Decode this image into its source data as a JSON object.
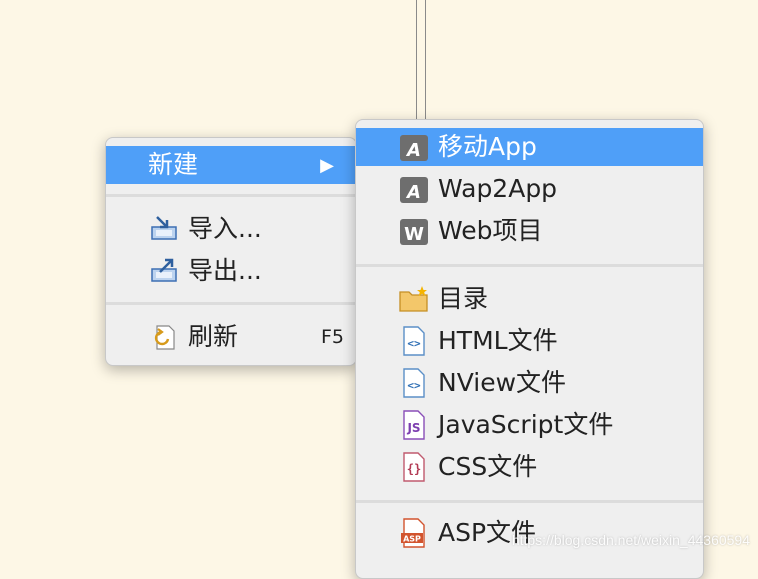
{
  "context_menu": {
    "items": [
      {
        "label": "新建",
        "icon": "none",
        "has_submenu": true,
        "selected": true,
        "arrow": "▶"
      },
      {
        "label": "导入...",
        "icon": "import-icon"
      },
      {
        "label": "导出...",
        "icon": "export-icon"
      },
      {
        "label": "刷新",
        "icon": "refresh-icon",
        "shortcut": "F5"
      }
    ]
  },
  "submenu": {
    "items": [
      {
        "label": "移动App",
        "icon": "hbuilder-app-icon",
        "selected": true
      },
      {
        "label": "Wap2App",
        "icon": "hbuilder-app-icon"
      },
      {
        "label": "Web项目",
        "icon": "web-project-icon"
      },
      {
        "label": "目录",
        "icon": "new-folder-icon"
      },
      {
        "label": "HTML文件",
        "icon": "html-file-icon"
      },
      {
        "label": "NView文件",
        "icon": "nview-file-icon"
      },
      {
        "label": "JavaScript文件",
        "icon": "js-file-icon"
      },
      {
        "label": "CSS文件",
        "icon": "css-file-icon"
      },
      {
        "label": "ASP文件",
        "icon": "asp-file-icon"
      }
    ]
  },
  "watermark": "https://blog.csdn.net/weixin_44360594",
  "colors": {
    "background": "#fdf7e6",
    "menu_bg": "#efefef",
    "highlight": "#4f9ff8"
  }
}
